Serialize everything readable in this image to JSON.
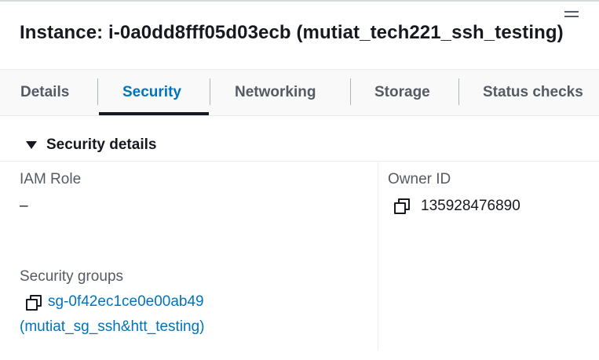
{
  "header": {
    "title": "Instance: i-0a0dd8fff05d03ecb (mutiat_tech221_ssh_testing)",
    "menu_icon": "hamburger-icon"
  },
  "tabs": [
    {
      "label": "Details",
      "active": false
    },
    {
      "label": "Security",
      "active": true
    },
    {
      "label": "Networking",
      "active": false
    },
    {
      "label": "Storage",
      "active": false
    },
    {
      "label": "Status checks",
      "active": false
    }
  ],
  "section": {
    "title": "Security details",
    "expanded": true,
    "toggle_icon": "caret-down-icon"
  },
  "fields": {
    "iam_role": {
      "label": "IAM Role",
      "value": "–"
    },
    "owner_id": {
      "label": "Owner ID",
      "value": "135928476890",
      "icon": "copy-icon"
    },
    "security_groups": {
      "label": "Security groups",
      "group_id": "sg-0f42ec1ce0e00ab49",
      "group_name": "(mutiat_sg_ssh&htt_testing)",
      "icon": "copy-icon"
    }
  },
  "colors": {
    "accent": "#0073bb",
    "text": "#16191f",
    "muted": "#545b64",
    "tab_bar_bg": "#f9f9f9"
  }
}
